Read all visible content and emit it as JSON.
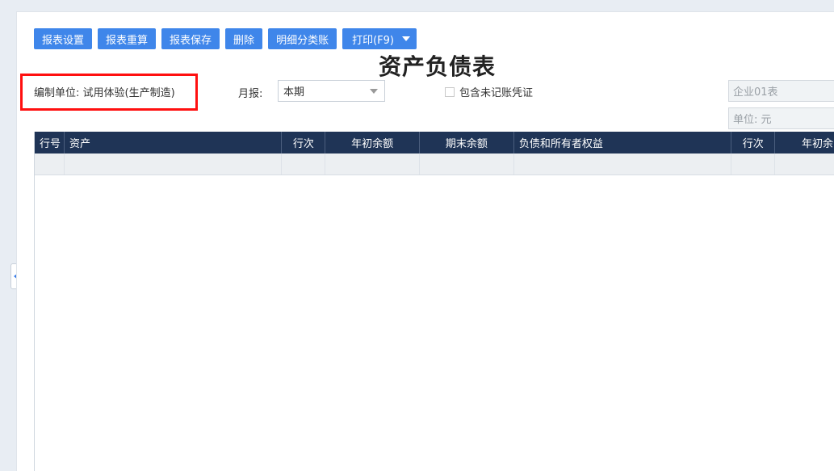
{
  "toolbar": {
    "settings_label": "报表设置",
    "recalc_label": "报表重算",
    "save_label": "报表保存",
    "delete_label": "删除",
    "ledger_label": "明细分类账",
    "print_label": "打印(F9)"
  },
  "report": {
    "title": "资产负债表"
  },
  "filters": {
    "company_label": "编制单位: 试用体验(生产制造)",
    "period_type_label": "月报:",
    "period_value": "本期",
    "include_unposted_label": "包含未记账凭证",
    "include_unposted_checked": false,
    "form_code": "企业01表",
    "unit_label": "单位: 元"
  },
  "table": {
    "headers": [
      "行号",
      "资产",
      "行次",
      "年初余额",
      "期末余额",
      "负债和所有者权益",
      "行次",
      "年初余"
    ],
    "rows": [
      [
        "",
        "",
        "",
        "",
        "",
        "",
        "",
        ""
      ]
    ]
  },
  "colors": {
    "primary_button": "#3f86ea",
    "table_header_bg": "#1f3456",
    "highlight_border": "#ff1010"
  },
  "icons": {
    "print_dropdown": "caret-down-icon",
    "sidebar_toggle": "collapse-left-icon"
  }
}
